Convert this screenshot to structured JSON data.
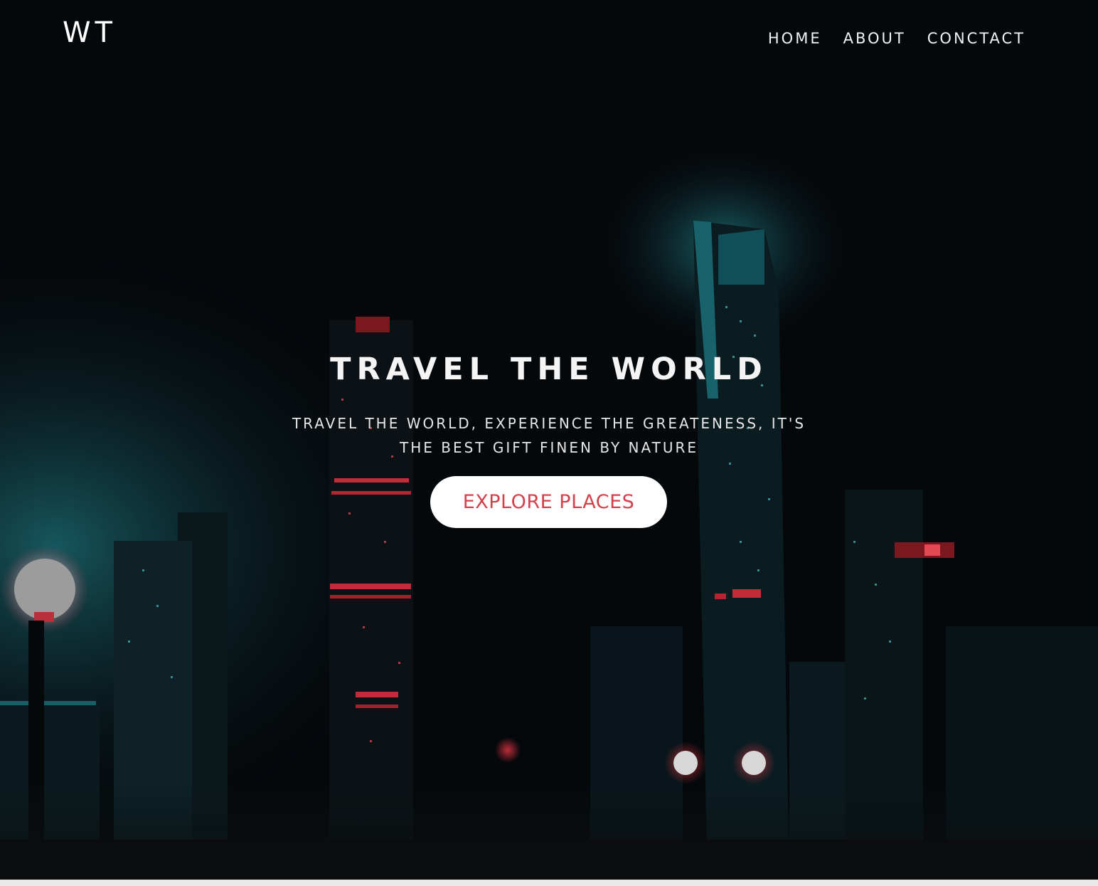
{
  "brand": {
    "logo": "WT"
  },
  "nav": {
    "items": [
      {
        "label": "HOME"
      },
      {
        "label": "ABOUT"
      },
      {
        "label": "CONCTACT"
      }
    ]
  },
  "hero": {
    "title": "TRAVEL THE WORLD",
    "subtitle_line1": "TRAVEL THE WORLD, EXPERIENCE THE GREATENESS, IT'S",
    "subtitle_line2": "THE BEST GIFT FINEN BY NATURE",
    "cta_label": "EXPLORE PLACES"
  },
  "colors": {
    "background": "#05080b",
    "accent_red": "#d4404c",
    "teal_glow": "#1fb7c4",
    "text": "#ffffff"
  }
}
